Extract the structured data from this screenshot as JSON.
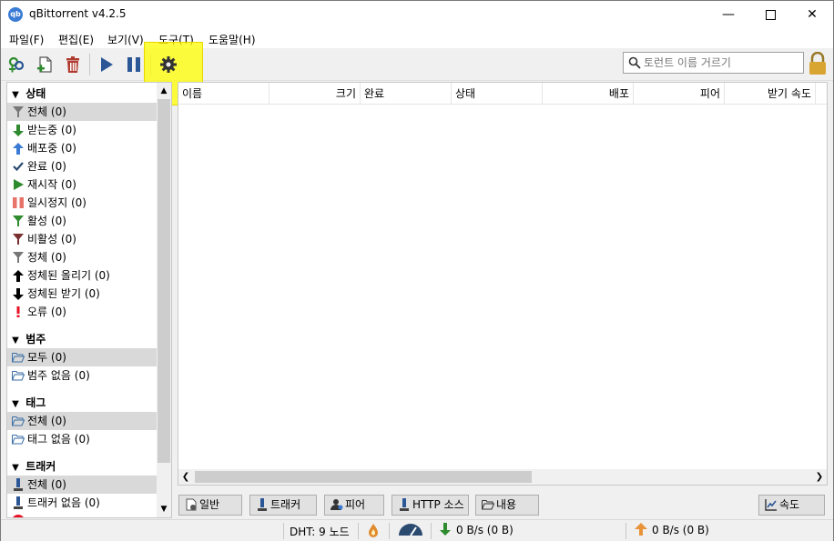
{
  "window": {
    "title": "qBittorrent v4.2.5",
    "app_icon_text": "qb"
  },
  "menu": [
    "파일(F)",
    "편집(E)",
    "보기(V)",
    "도구(T)",
    "도움말(H)"
  ],
  "toolbar": {
    "search_placeholder": "토런트 이름 거르기",
    "buttons": [
      "add-link",
      "add-torrent-file",
      "delete",
      "resume",
      "pause",
      "options"
    ]
  },
  "sidebar": {
    "status_header": "상태",
    "status_items": [
      "전체 (0)",
      "받는중 (0)",
      "배포중 (0)",
      "완료 (0)",
      "재시작 (0)",
      "일시정지 (0)",
      "활성 (0)",
      "비활성 (0)",
      "정체 (0)",
      "정체된 올리기 (0)",
      "정체된 받기 (0)",
      "오류 (0)"
    ],
    "category_header": "범주",
    "category_items": [
      "모두 (0)",
      "범주 없음 (0)"
    ],
    "tag_header": "태그",
    "tag_items": [
      "전체 (0)",
      "태그 없음 (0)"
    ],
    "tracker_header": "트래커",
    "tracker_items": [
      "전체 (0)",
      "트래커 없음 (0)"
    ]
  },
  "list": {
    "columns": [
      "이름",
      "크기",
      "완료",
      "상태",
      "배포",
      "피어",
      "받기 속도"
    ]
  },
  "tabs": [
    "일반",
    "트래커",
    "피어",
    "HTTP 소스",
    "내용"
  ],
  "speed_button": "속도",
  "status": {
    "dht": "DHT: 9 노드",
    "download": "0 B/s (0 B)",
    "upload": "0 B/s (0 B)"
  },
  "colors": {
    "highlight": "#ffff00",
    "accent_blue": "#3a7bd5",
    "green": "#2e8b2e",
    "red": "#e81123"
  }
}
